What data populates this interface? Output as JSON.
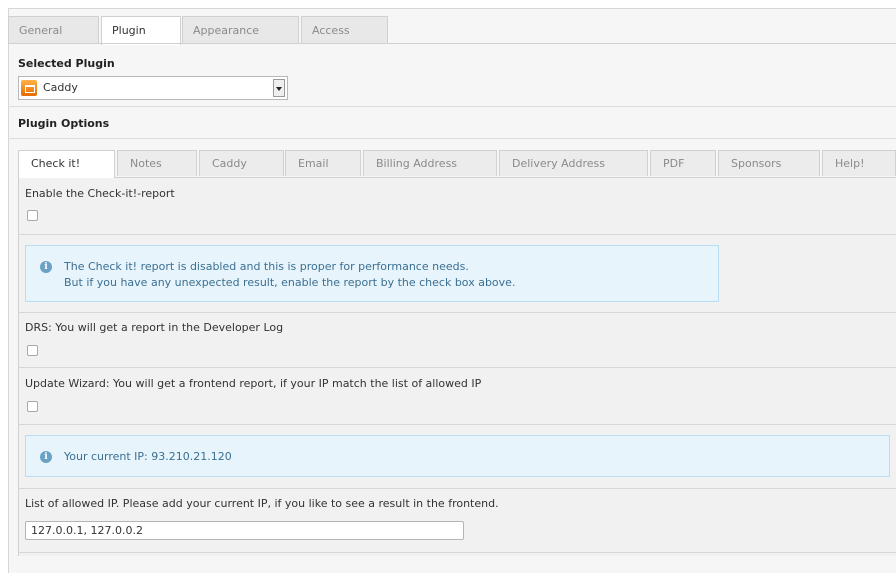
{
  "top_tabs": [
    {
      "label": "General"
    },
    {
      "label": "Plugin"
    },
    {
      "label": "Appearance"
    },
    {
      "label": "Access"
    }
  ],
  "selected_plugin": {
    "title": "Selected Plugin",
    "value": "Caddy",
    "icon": "cart-icon"
  },
  "plugin_options_title": "Plugin Options",
  "option_tabs": [
    {
      "label": "Check it!"
    },
    {
      "label": "Notes"
    },
    {
      "label": "Caddy"
    },
    {
      "label": "Email"
    },
    {
      "label": "Billing Address"
    },
    {
      "label": "Delivery Address"
    },
    {
      "label": "PDF"
    },
    {
      "label": "Sponsors"
    },
    {
      "label": "Help!"
    }
  ],
  "panel": {
    "enable_report_label": "Enable the Check-it!-report",
    "enable_report_checked": false,
    "info_disabled": {
      "line1": "The Check it! report is disabled and this is proper for performance needs.",
      "line2": "But if you have any unexpected result, enable the report by the check box above."
    },
    "drs_label": "DRS: You will get a report in the Developer Log",
    "drs_checked": false,
    "wizard_label": "Update Wizard: You will get a frontend report, if your IP match the list of allowed IP",
    "wizard_checked": false,
    "current_ip_text": "Your current IP: 93.210.21.120",
    "allowed_ip_label": "List of allowed IP. Please add your current IP, if you like to see a result in the frontend.",
    "allowed_ip_value": "127.0.0.1, 127.0.0.2"
  },
  "colors": {
    "info_background": "#e8f4fb",
    "info_border": "#b9def1",
    "info_text": "#3a6f92",
    "plugin_icon": "#f08a1c"
  }
}
